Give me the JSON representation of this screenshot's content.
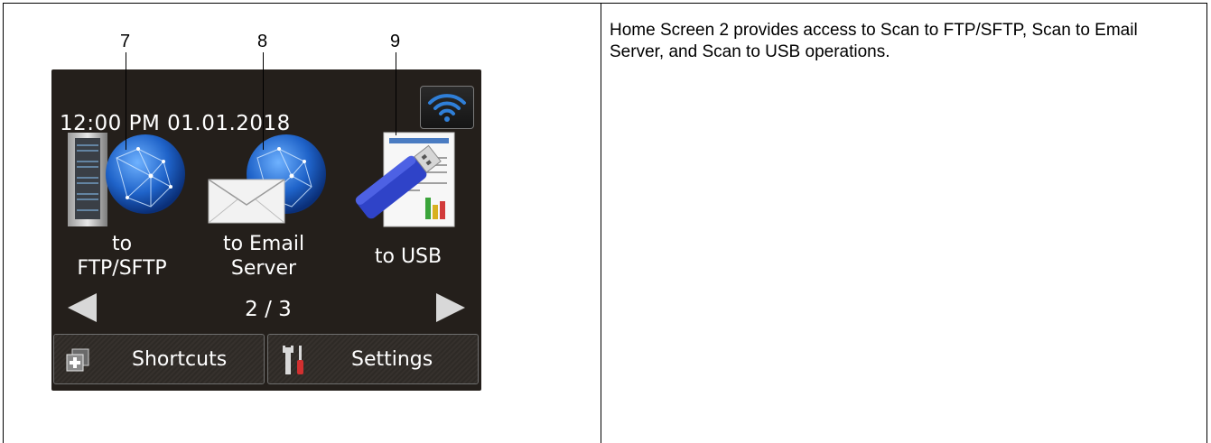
{
  "callouts": {
    "c7": "7",
    "c8": "8",
    "c9": "9"
  },
  "description": "Home Screen 2 provides access to Scan to FTP/SFTP, Scan to Email Server, and Scan to USB operations.",
  "screen": {
    "datetime": "12:00 PM 01.01.2018",
    "tiles": [
      {
        "line1": "to",
        "line2": "FTP/SFTP",
        "icon": "ftp-server-globe-icon"
      },
      {
        "line1": "to Email",
        "line2": "Server",
        "icon": "email-globe-icon"
      },
      {
        "line1": "to USB",
        "icon": "usb-document-icon"
      }
    ],
    "page_indicator": "2 / 3",
    "shortcuts_label": "Shortcuts",
    "settings_label": "Settings",
    "accent_color": "#2f7fd8"
  }
}
